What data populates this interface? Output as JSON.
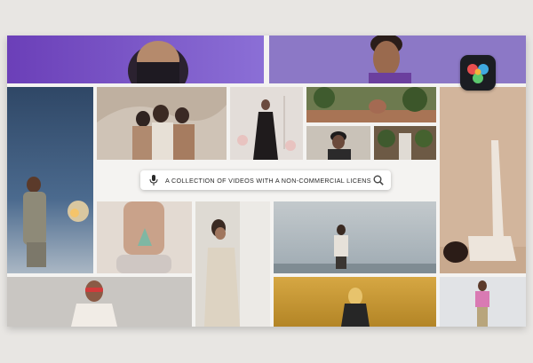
{
  "search": {
    "query": "A COLLECTION OF VIDEOS WITH A NON-COMMERCIAL LICENSE|",
    "mic_icon": "microphone-icon",
    "search_icon": "magnifier-icon"
  },
  "logo": {
    "name": "davinci-resolve-logo",
    "colors": [
      "#e94f4f",
      "#f2b33d",
      "#3fa8e0",
      "#5cc86e"
    ]
  },
  "colors": {
    "top_band_left": "#7a52c8",
    "top_band_right": "#8d78c4",
    "board_background": "#f4f3f1",
    "page_background": "#e8e6e3"
  }
}
